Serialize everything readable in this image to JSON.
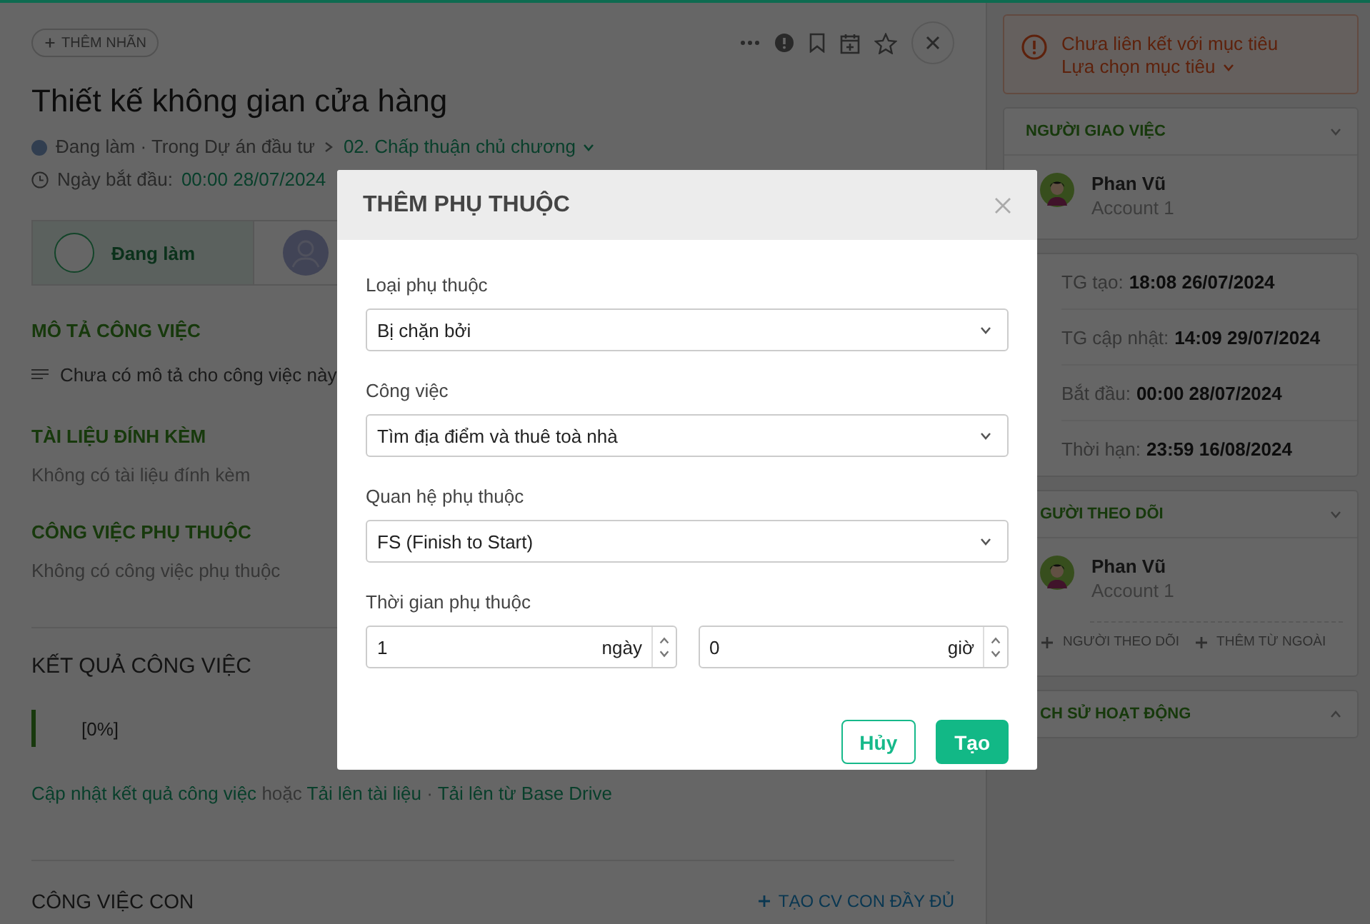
{
  "task": {
    "tag_button": "THÊM NHÃN",
    "title": "Thiết kế không gian cửa hàng",
    "status_path": "Đang làm · Trong Dự án đầu tư",
    "stage": "02. Chấp thuận chủ chương",
    "start_label": "Ngày bắt đầu:",
    "start_value": "00:00 28/07/2024",
    "status_label": "Đang làm"
  },
  "sections": [
    {
      "heading": "MÔ TẢ CÔNG VIỆC",
      "kind": "description",
      "text": "Chưa có mô tả cho công việc này"
    },
    {
      "heading": "TÀI LIỆU ĐÍNH KÈM",
      "kind": "empty",
      "text": "Không có tài liệu đính kèm"
    },
    {
      "heading": "CÔNG VIỆC PHỤ THUỘC",
      "kind": "empty",
      "text": "Không có công việc phụ thuộc"
    }
  ],
  "results": {
    "heading": "KẾT QUẢ CÔNG VIỆC",
    "progress": "[0%]",
    "actions": [
      {
        "text": "Cập nhật kết quả công việc",
        "kind": "link"
      },
      {
        "text": "hoặc",
        "kind": "plain"
      },
      {
        "text": "Tải lên tài liệu",
        "kind": "link"
      },
      {
        "text": "·",
        "kind": "plain"
      },
      {
        "text": "Tải lên từ Base Drive",
        "kind": "link"
      }
    ]
  },
  "subtasks": {
    "heading": "CÔNG VIỆC CON",
    "action": "TẠO CV CON ĐẦY ĐỦ"
  },
  "sidebar": {
    "alert": {
      "text": "Chưa liên kết với mục tiêu",
      "action": "Lựa chọn mục tiêu"
    },
    "assigner": {
      "heading": "NGƯỜI GIAO VIỆC",
      "expanded": true,
      "name": "Phan Vũ",
      "account": "Account 1"
    },
    "timestamps": [
      {
        "label": "TG tạo:",
        "value": "18:08 26/07/2024"
      },
      {
        "label": "TG cập nhật:",
        "value": "14:09 29/07/2024"
      },
      {
        "label": "Bắt đầu:",
        "value": "00:00 28/07/2024"
      },
      {
        "label": "Thời hạn:",
        "value": "23:59 16/08/2024"
      }
    ],
    "followers": {
      "heading": "GƯỜI THEO DÕI",
      "expanded": true,
      "name": "Phan Vũ",
      "account": "Account 1",
      "actions": [
        "NGƯỜI THEO DÕI",
        "THÊM TỪ NGOÀI"
      ]
    },
    "history": {
      "heading": "CH SỬ HOẠT ĐỘNG",
      "expanded": false
    }
  },
  "modal": {
    "title": "THÊM PHỤ THUỘC",
    "fields": [
      {
        "label": "Loại phụ thuộc",
        "value": "Bị chặn bởi"
      },
      {
        "label": "Công việc",
        "value": "Tìm địa điểm và thuê toà nhà"
      },
      {
        "label": "Quan hệ phụ thuộc",
        "value": "FS (Finish to Start)"
      }
    ],
    "duration": {
      "label": "Thời gian phụ thuộc",
      "inputs": [
        {
          "value": "1",
          "unit": "ngày"
        },
        {
          "value": "0",
          "unit": "giờ"
        }
      ]
    },
    "buttons": [
      {
        "label": "Hủy",
        "kind": "secondary"
      },
      {
        "label": "Tạo",
        "kind": "primary"
      }
    ]
  }
}
